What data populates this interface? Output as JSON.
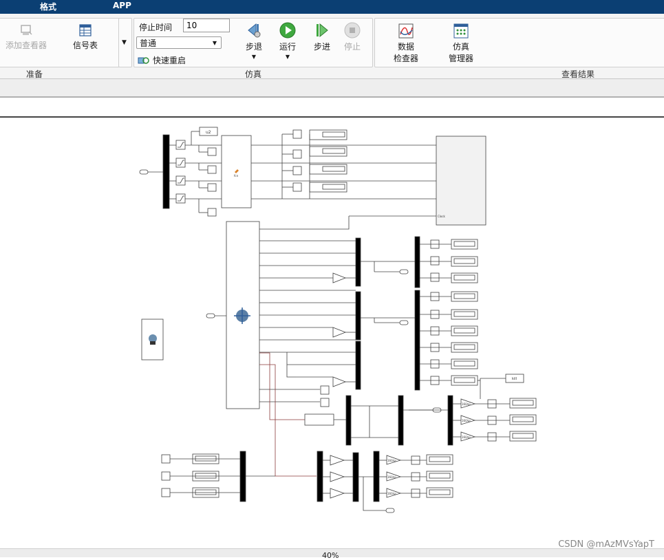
{
  "menu": {
    "tabs": [
      {
        "label": "格式"
      },
      {
        "label": "APP"
      }
    ]
  },
  "ribbon": {
    "prepare": {
      "add_viewer_label": "添加查看器",
      "signal_table_label": "信号表",
      "group_label": "准备"
    },
    "simulate": {
      "stop_time_label": "停止时间",
      "stop_time_value": "10",
      "mode_value": "普通",
      "fast_restart_label": "快速重启",
      "step_back_label": "步退",
      "run_label": "运行",
      "step_forward_label": "步进",
      "stop_label": "停止",
      "group_label": "仿真"
    },
    "review": {
      "data_inspector_line1": "数据",
      "data_inspector_line2": "检查器",
      "sim_manager_line1": "仿真",
      "sim_manager_line2": "管理器",
      "group_label": "查看结果"
    }
  },
  "diagram": {
    "label_u2": "u2",
    "label_clock": "Clock",
    "label_fcn": "fcn",
    "label_kill": "kill",
    "label_160": "160/pi"
  },
  "status": {
    "zoom": "40%"
  },
  "watermark": "CSDN @mAzMVsYapT",
  "colors": {
    "titlebar": "#0b3f73",
    "block_stroke": "#404040",
    "bus_fill": "#000000"
  }
}
